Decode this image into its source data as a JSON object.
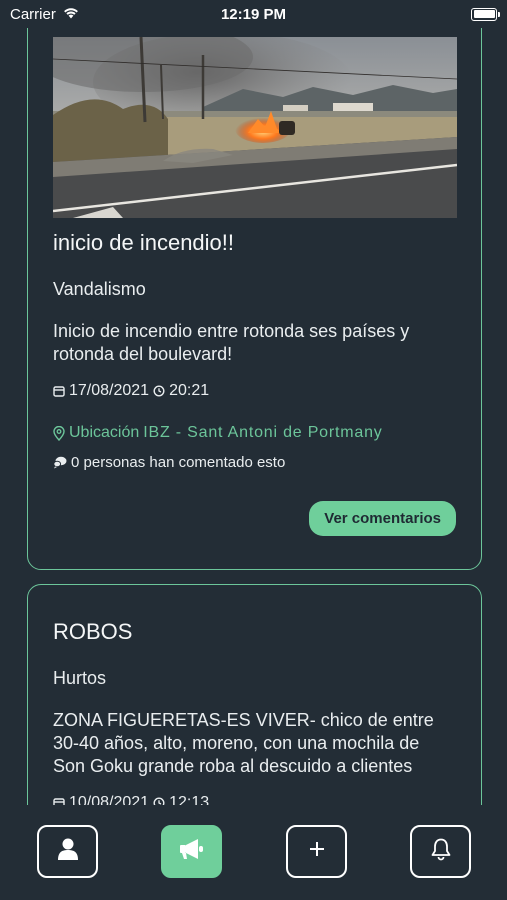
{
  "status_bar": {
    "carrier": "Carrier",
    "time": "12:19 PM"
  },
  "posts": [
    {
      "title": "inicio de incendio!!",
      "category": "Vandalismo",
      "description": "Inicio de incendio entre rotonda ses países y rotonda del boulevard!",
      "date": "17/08/2021",
      "time": "20:21",
      "location_label": "Ubicación",
      "location_value": "IBZ - Sant Antoni de Portmany",
      "comments_text": "0 personas han comentado esto",
      "button_label": "Ver comentarios"
    },
    {
      "title": "ROBOS",
      "category": "Hurtos",
      "description": "ZONA FIGUERETAS-ES VIVER- chico de entre 30-40 años, alto, moreno, con una mochila de Son Goku grande roba al descuido a clientes",
      "date": "10/08/2021",
      "time": "12:13"
    }
  ],
  "colors": {
    "background": "#232d36",
    "accent": "#6fcf9b",
    "border": "#6cc59a"
  },
  "tabs": [
    {
      "icon": "user-icon",
      "active": false
    },
    {
      "icon": "megaphone-icon",
      "active": true
    },
    {
      "icon": "plus-icon",
      "active": false
    },
    {
      "icon": "bell-icon",
      "active": false
    }
  ]
}
